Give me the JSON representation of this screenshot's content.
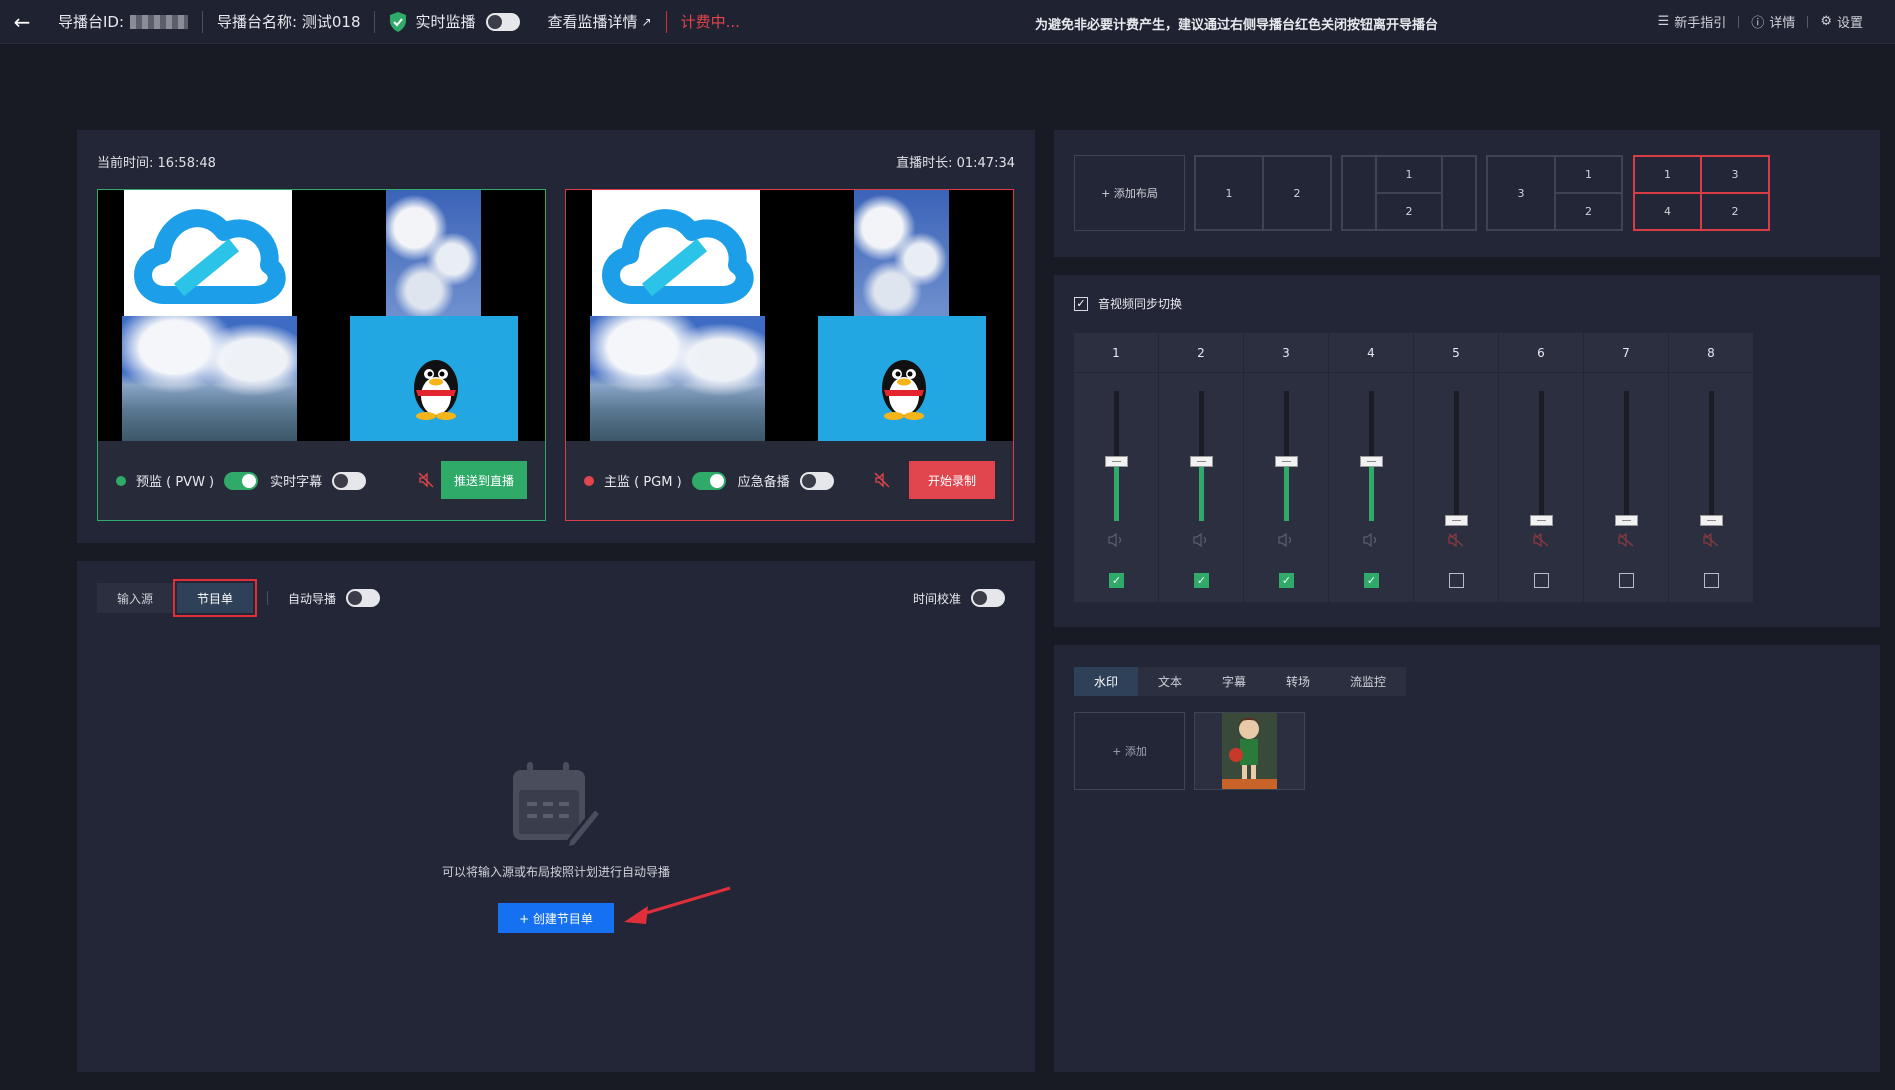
{
  "topbar": {
    "back_icon": "arrow-left-icon",
    "studio_id_label": "导播台ID:",
    "studio_name_label": "导播台名称: 测试018",
    "monitoring_label": "实时监播",
    "view_details_label": "查看监播详情",
    "billing_status": "计费中...",
    "notice": "为避免非必要计费产生，建议通过右侧导播台红色关闭按钮离开导播台",
    "guide_label": "新手指引",
    "detail_label": "详情",
    "settings_label": "设置"
  },
  "preview": {
    "current_time_label": "当前时间: 16:58:48",
    "live_duration_label": "直播时长: 01:47:34",
    "pvw_label": "预监 ( PVW )",
    "subtitle_label": "实时字幕",
    "push_button": "推送到直播",
    "pgm_label": "主监 ( PGM )",
    "backup_label": "应急备播",
    "record_button": "开始录制"
  },
  "playlist": {
    "tabs": [
      "输入源",
      "节目单"
    ],
    "auto_direct_label": "自动导播",
    "time_calibration_label": "时间校准",
    "empty_text": "可以将输入源或布局按照计划进行自动导播",
    "create_button": "+ 创建节目单"
  },
  "layouts": {
    "add_label": "+ 添加布局",
    "layout2": [
      "1",
      "2"
    ],
    "layout3": [
      "1",
      "2"
    ],
    "layout4": [
      "3",
      "1",
      "2"
    ],
    "layout5": [
      "1",
      "3",
      "4",
      "2"
    ]
  },
  "audio": {
    "sync_label": "音视频同步切换",
    "channels": [
      {
        "num": "1",
        "level": 0.45,
        "active": true
      },
      {
        "num": "2",
        "level": 0.45,
        "active": true
      },
      {
        "num": "3",
        "level": 0.45,
        "active": true
      },
      {
        "num": "4",
        "level": 0.45,
        "active": true
      },
      {
        "num": "5",
        "level": 0.0,
        "active": false
      },
      {
        "num": "6",
        "level": 0.0,
        "active": false
      },
      {
        "num": "7",
        "level": 0.0,
        "active": false
      },
      {
        "num": "8",
        "level": 0.0,
        "active": false
      }
    ]
  },
  "watermark": {
    "tabs": [
      "水印",
      "文本",
      "字幕",
      "转场",
      "流监控"
    ],
    "add_label": "+ 添加"
  },
  "colors": {
    "green": "#2faa68",
    "red": "#e1454d",
    "blue": "#1670f2"
  }
}
